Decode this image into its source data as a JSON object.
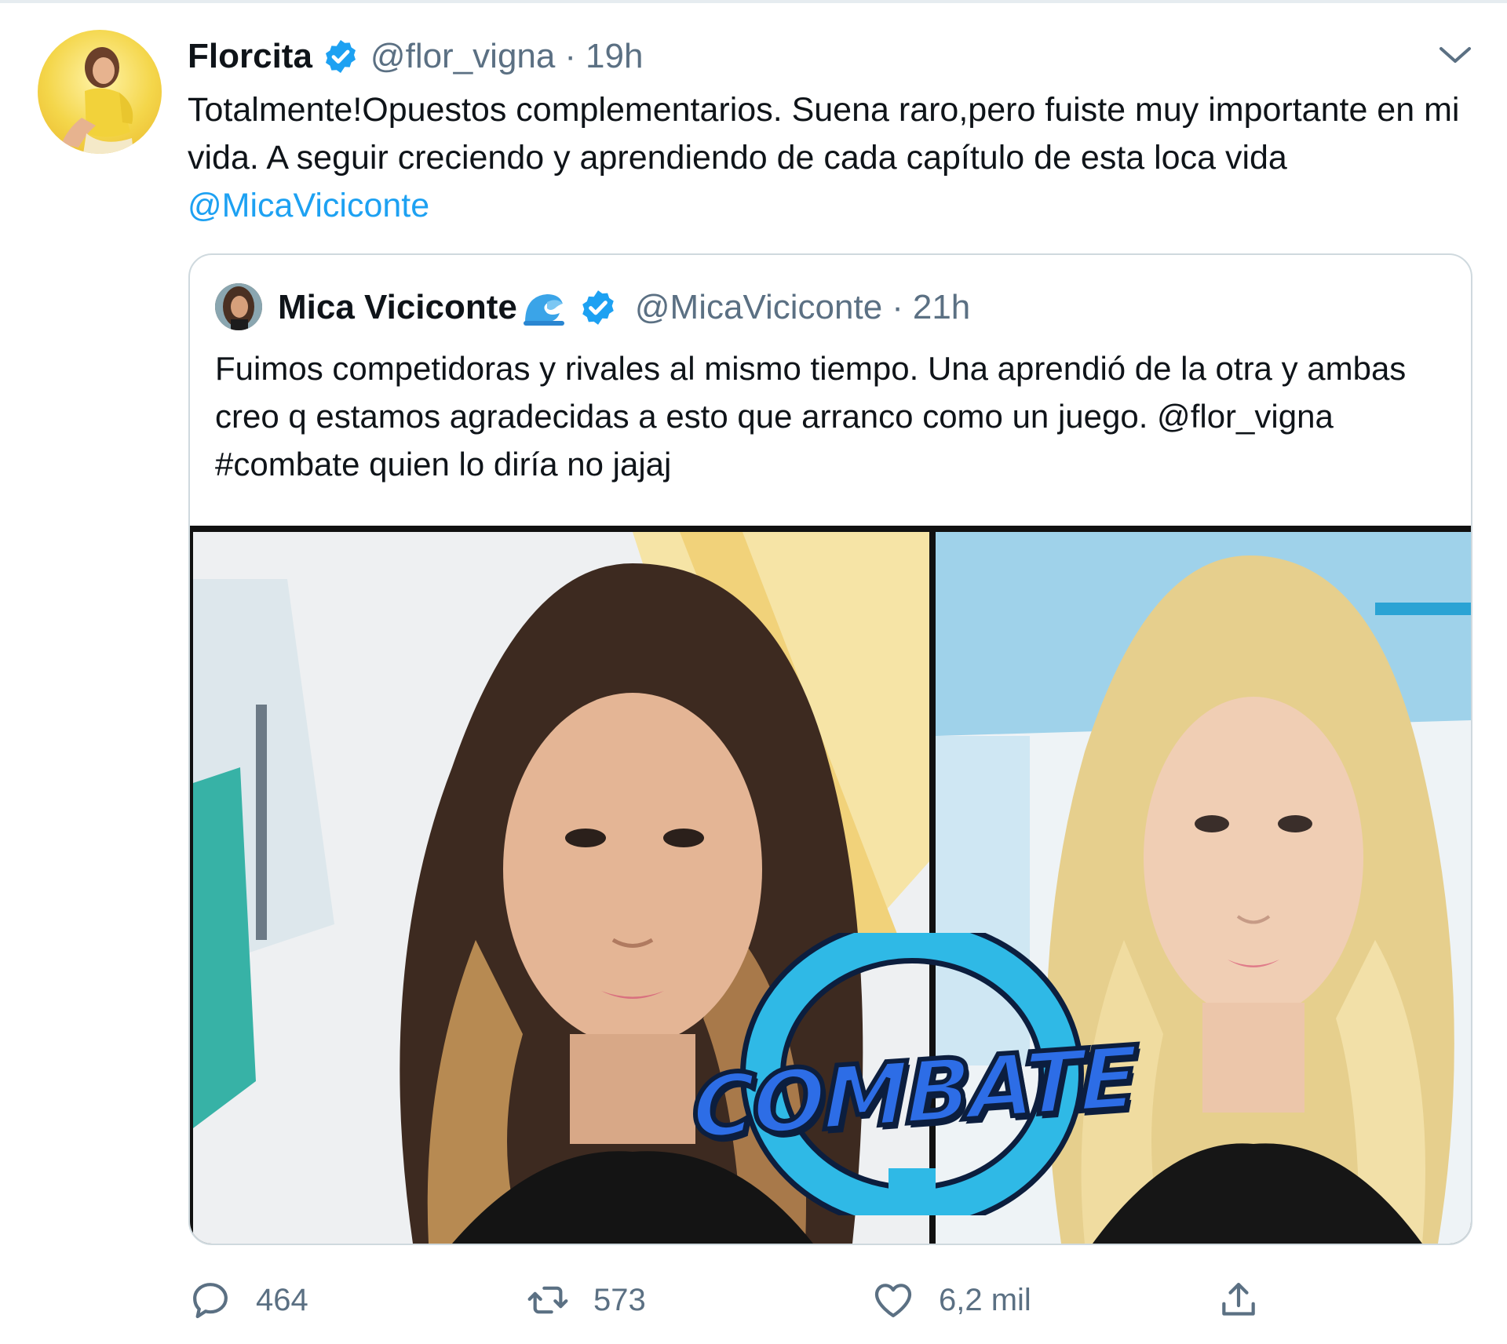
{
  "tweet": {
    "display_name": "Florcita",
    "handle": "@flor_vigna",
    "separator": "·",
    "time": "19h",
    "text_before_mention": "Totalmente!Opuestos complementarios. Suena raro,pero fuiste muy importante en mi vida. A seguir creciendo y aprendiendo de cada capítulo de esta loca vida ",
    "mention": "@MicaViciconte"
  },
  "quoted_tweet": {
    "display_name": "Mica Viciconte",
    "handle": "@MicaViciconte",
    "separator": "·",
    "time": "21h",
    "text": "Fuimos competidoras y rivales al mismo tiempo. Una aprendió de la otra y ambas creo q estamos agradecidas a esto que arranco como un juego. @flor_vigna  #combate quien lo diría no jajaj",
    "media_logo_text": "COMBATE"
  },
  "actions": {
    "reply_count": "464",
    "retweet_count": "573",
    "like_count": "6,2 mil"
  },
  "icons": {
    "verified": "verified-badge-icon",
    "caret": "chevron-down-icon",
    "emoji": "water-wave-icon",
    "reply": "reply-icon",
    "retweet": "retweet-icon",
    "like": "heart-icon",
    "share": "share-icon"
  },
  "colors": {
    "link": "#1da1f2",
    "secondary_text": "#5b7083",
    "primary_text": "#0f1419",
    "border": "#cfd9de"
  }
}
